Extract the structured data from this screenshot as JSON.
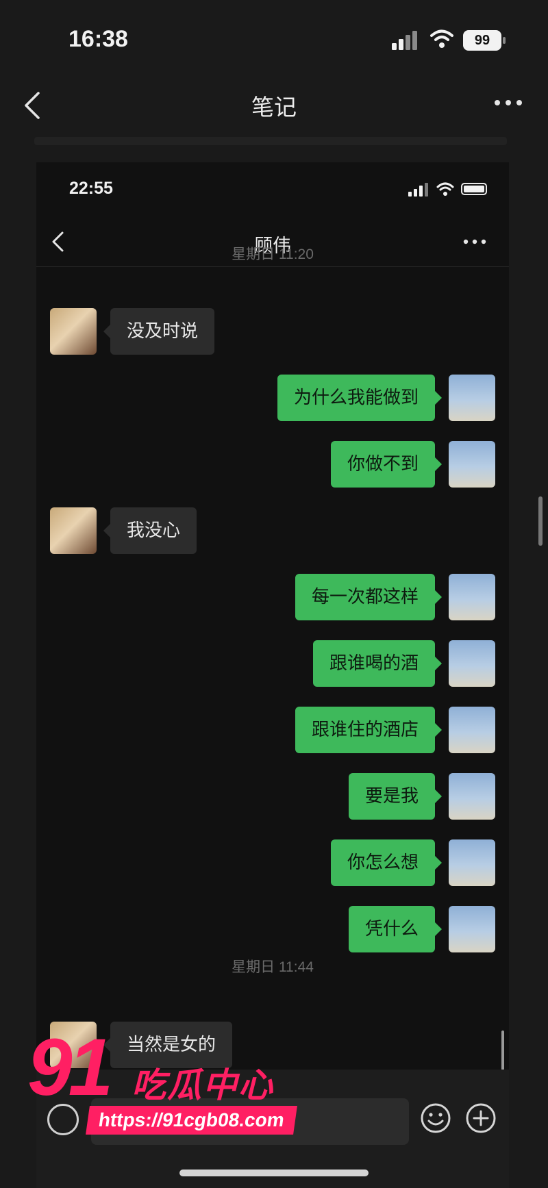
{
  "outer": {
    "status": {
      "time": "16:38",
      "battery": "99"
    },
    "nav": {
      "title": "笔记"
    }
  },
  "inner": {
    "status": {
      "time": "22:55"
    },
    "nav": {
      "title": "顾伟"
    },
    "timestamps": [
      "星期日 11:20",
      "星期日 11:44"
    ],
    "messages": [
      {
        "side": "left",
        "text": "没及时说"
      },
      {
        "side": "right",
        "text": "为什么我能做到"
      },
      {
        "side": "right",
        "text": "你做不到"
      },
      {
        "side": "left",
        "text": "我没心"
      },
      {
        "side": "right",
        "text": "每一次都这样"
      },
      {
        "side": "right",
        "text": "跟谁喝的酒"
      },
      {
        "side": "right",
        "text": "跟谁住的酒店"
      },
      {
        "side": "right",
        "text": "要是我"
      },
      {
        "side": "right",
        "text": "你怎么想"
      },
      {
        "side": "right",
        "text": "凭什么"
      },
      {
        "side": "left",
        "text": "当然是女的"
      }
    ]
  },
  "watermark": {
    "number": "91",
    "name": "吃瓜中心",
    "url": "https://91cgb08.com"
  },
  "colors": {
    "accent_green": "#3eb95b",
    "watermark_pink": "#ff1f63",
    "background": "#1a1a1a"
  },
  "icons": [
    "back-chevron-icon",
    "more-dots-icon",
    "signal-icon",
    "wifi-icon",
    "battery-icon",
    "voice-icon",
    "emoji-icon",
    "plus-icon"
  ]
}
